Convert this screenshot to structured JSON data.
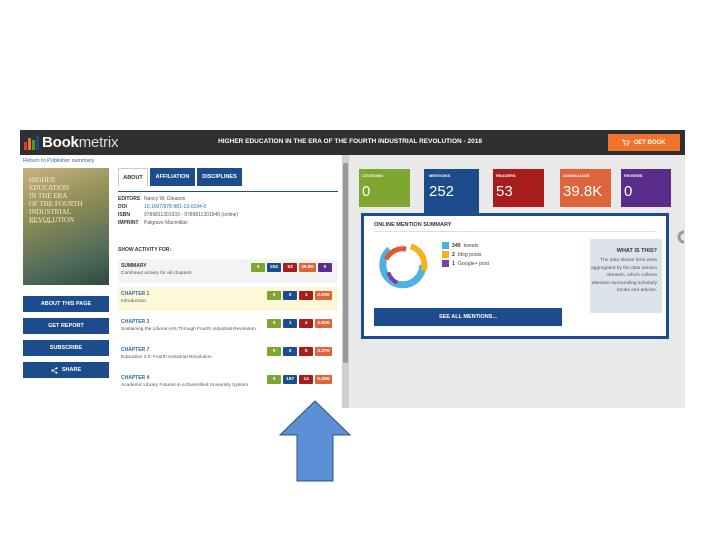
{
  "app": {
    "logo_text_bold": "Book",
    "logo_text_rest": "metrix",
    "logo_bar_colors": [
      "#e23b3b",
      "#f0732b",
      "#4c9a2a",
      "#1d4c8c",
      "#6b3fa0"
    ]
  },
  "book_title": "HIGHER EDUCATION IN THE ERA OF THE FOURTH INDUSTRIAL REVOLUTION - 2018",
  "get_book_label": "GET BOOK",
  "return_link": "Return to Publisher summary",
  "cover": {
    "lines": [
      "HIGHER",
      "EDUCATION",
      "IN THE ERA",
      "OF THE FOURTH",
      "INDUSTRIAL",
      "REVOLUTION"
    ],
    "sub": "Nancy W. Gleason"
  },
  "side_buttons": [
    {
      "label": "ABOUT THIS PAGE",
      "icon": ""
    },
    {
      "label": "GET REPORT",
      "icon": ""
    },
    {
      "label": "SUBSCRIBE",
      "icon": ""
    },
    {
      "label": "SHARE",
      "icon": "share-icon"
    }
  ],
  "tabs": [
    "ABOUT",
    "AFFILIATION",
    "DISCIPLINES"
  ],
  "info": {
    "editors_label": "EDITORS",
    "editors_value": "Nancy W. Gleason",
    "doi_label": "DOI",
    "doi_value": "10.1007/978-981-13-0194-0",
    "isbn_label": "ISBN",
    "isbn_value": "9789811301933 - 9789811301940 (online)",
    "imprint_label": "IMPRINT",
    "imprint_value": "Palgrave Macmillan"
  },
  "show_activity_label": "SHOW ACTIVITY FOR:",
  "rows": [
    {
      "title": "SUMMARY",
      "sub": "Combined activity for all chapters",
      "pills": [
        "0",
        "252",
        "53",
        "39.8K",
        "0"
      ]
    },
    {
      "title": "CHAPTER 1",
      "sub": "Introduction",
      "pills": [
        "0",
        "0",
        "1",
        "2.63K"
      ]
    },
    {
      "title": "CHAPTER 3",
      "sub": "Sustaining the Liberal Arts Through Fourth Industrial Revolution",
      "pills": [
        "0",
        "1",
        "4",
        "3.92K"
      ]
    },
    {
      "title": "CHAPTER 7",
      "sub": "Education 4.0: Fourth Industrial Revolution",
      "pills": [
        "0",
        "0",
        "5",
        "3.37K"
      ]
    },
    {
      "title": "CHAPTER 4",
      "sub": "Academic Library Futures in a Diversified University System",
      "pills": [
        "0",
        "197",
        "14",
        "6.00K"
      ]
    }
  ],
  "pill_colors": [
    "#7ea630",
    "#1d4c8c",
    "#a81c1c",
    "#e0643a",
    "#5a2d8a"
  ],
  "stats": [
    {
      "label": "CITATIONS",
      "value": "0",
      "color": "#7ea630"
    },
    {
      "label": "MENTIONS",
      "value": "252",
      "color": "#1d4c8c"
    },
    {
      "label": "READERS",
      "value": "53",
      "color": "#a81c1c"
    },
    {
      "label": "DOWNLOADS",
      "value": "39.8K",
      "color": "#e0643a"
    },
    {
      "label": "REVIEWS",
      "value": "0",
      "color": "#5a2d8a"
    }
  ],
  "mention_summary": {
    "title": "ONLINE MENTION SUMMARY",
    "legend": [
      {
        "count": "240",
        "label": "tweets",
        "color": "#4ab3e0"
      },
      {
        "count": "2",
        "label": "blog posts",
        "color": "#f2b41a"
      },
      {
        "count": "1",
        "label": "Google+ post",
        "color": "#7b3f9e"
      }
    ],
    "donut_colors": [
      "#4ab3e0",
      "#f2b41a",
      "#e8542e",
      "#7b3f9e"
    ],
    "see_all_label": "SEE ALL MENTIONS...",
    "what_title": "WHAT IS THIS?",
    "what_text": "The data shown here were aggregated by the data service Altmetric, which collects attention surrounding scholarly books and articles."
  },
  "arrow_color": "#5b8fd6"
}
